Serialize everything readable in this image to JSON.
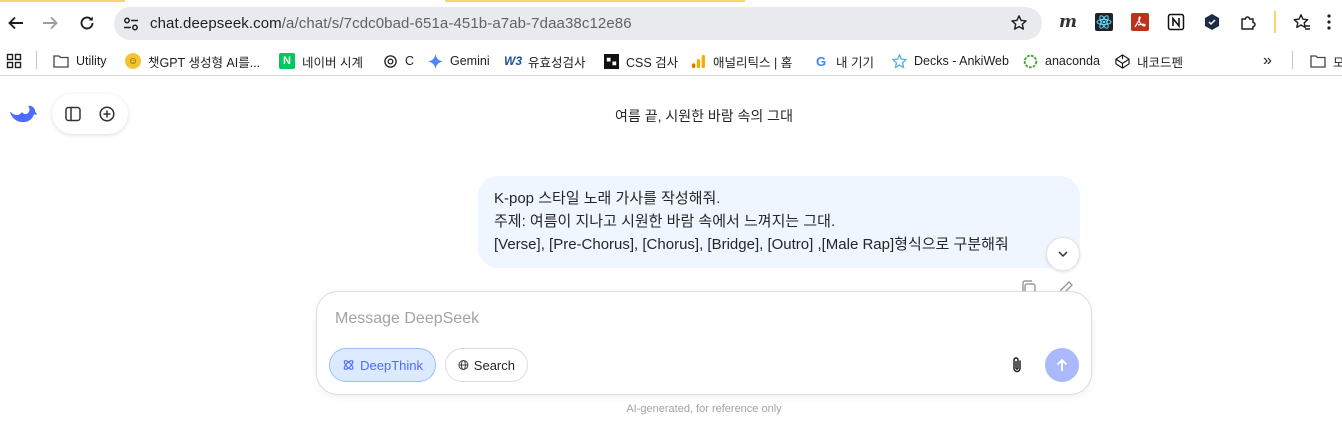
{
  "browser": {
    "url_host": "chat.deepseek.com",
    "url_path": "/a/chat/s/7cdc0bad-651a-451b-a7ab-7daa38c12e86",
    "nav": [
      "back-icon",
      "forward-icon",
      "reload-icon"
    ],
    "extensions": [
      "m-extension-icon",
      "react-devtools-icon",
      "pdf-icon",
      "notion-icon",
      "hexagon-extension-icon",
      "extensions-puzzle-icon",
      "reading-list-star-icon",
      "more-menu-icon"
    ]
  },
  "bookmarks": {
    "items": [
      {
        "label": "Utility",
        "icon": "folder-icon"
      },
      {
        "label": "챗GPT 생성형 AI를...",
        "icon": "smiley-icon"
      },
      {
        "label": "네이버 시계",
        "icon": "naver-icon"
      },
      {
        "label": "C",
        "icon": "openai-icon"
      },
      {
        "label": "Gemini",
        "icon": "gemini-icon"
      },
      {
        "label": "유효성검사",
        "icon": "w3c-icon"
      },
      {
        "label": "CSS 검사",
        "icon": "css-icon"
      },
      {
        "label": "애널리틱스 | 홈",
        "icon": "analytics-icon"
      },
      {
        "label": "내 기기",
        "icon": "google-icon"
      },
      {
        "label": "Decks - AnkiWeb",
        "icon": "anki-icon"
      },
      {
        "label": "anaconda",
        "icon": "anaconda-icon"
      },
      {
        "label": "내코드펜",
        "icon": "codepen-icon"
      }
    ],
    "overflow": "»",
    "trailing_folder": "모"
  },
  "chat": {
    "title": "여름 끝, 시원한 바람 속의 그대",
    "message_lines": [
      "K-pop 스타일 노래 가사를 작성해줘.",
      "주제: 여름이 지나고 시원한 바람 속에서 느껴지는 그대.",
      "[Verse], [Pre-Chorus], [Chorus], [Bridge], [Outro] ,[Male Rap]형식으로 구분해줘"
    ]
  },
  "composer": {
    "placeholder": "Message DeepSeek",
    "deepthink_label": "DeepThink",
    "search_label": "Search",
    "footnote": "AI-generated, for reference only"
  },
  "colors": {
    "accent": "#4d6bfe",
    "bubble_bg": "#eff6ff",
    "send_disabled": "#a9b9fb"
  }
}
